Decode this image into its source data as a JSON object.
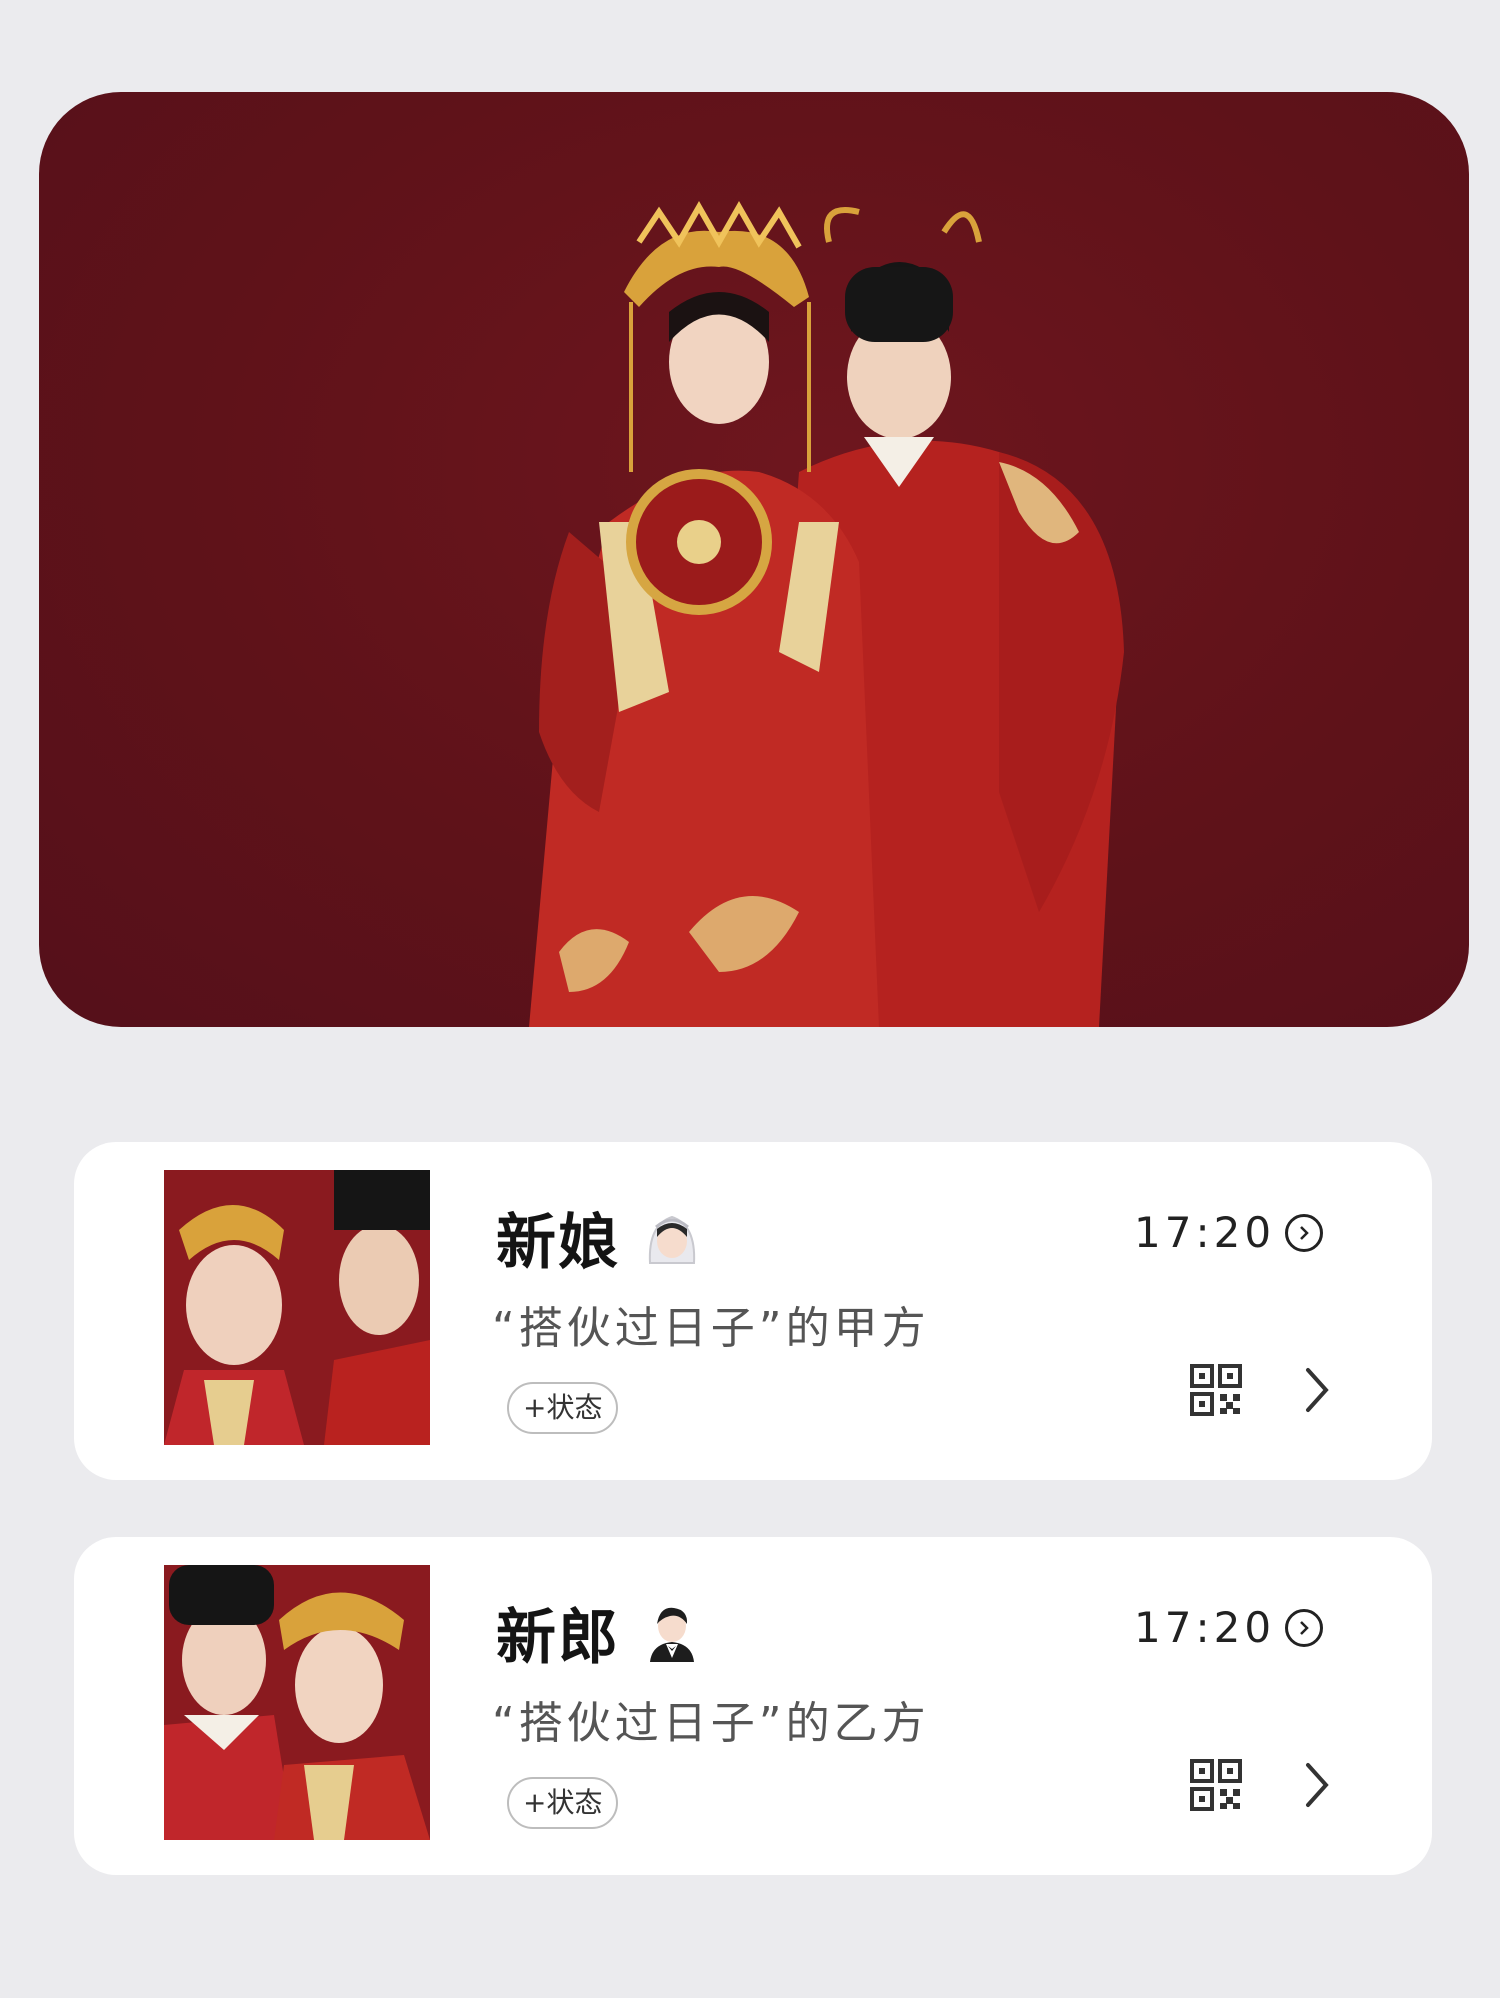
{
  "hero": {
    "image": "bride-and-groom-portrait",
    "background_color": "#5f1219"
  },
  "cards": [
    {
      "title": "新娘",
      "emoji_icon": "bride-with-veil-emoji",
      "subtitle": "“搭伙过日子”的甲方",
      "time": "17:20",
      "status_label": "+状态",
      "qr_icon": "qr-code-icon",
      "arrow_icon": "chevron-right-icon"
    },
    {
      "title": "新郎",
      "emoji_icon": "groom-in-tuxedo-emoji",
      "subtitle": "“搭伙过日子”的乙方",
      "time": "17:20",
      "status_label": "+状态",
      "qr_icon": "qr-code-icon",
      "arrow_icon": "chevron-right-icon"
    }
  ],
  "colors": {
    "accent_red": "#c0262b",
    "gold": "#d8a94a",
    "page_bg": "#ebebee"
  }
}
